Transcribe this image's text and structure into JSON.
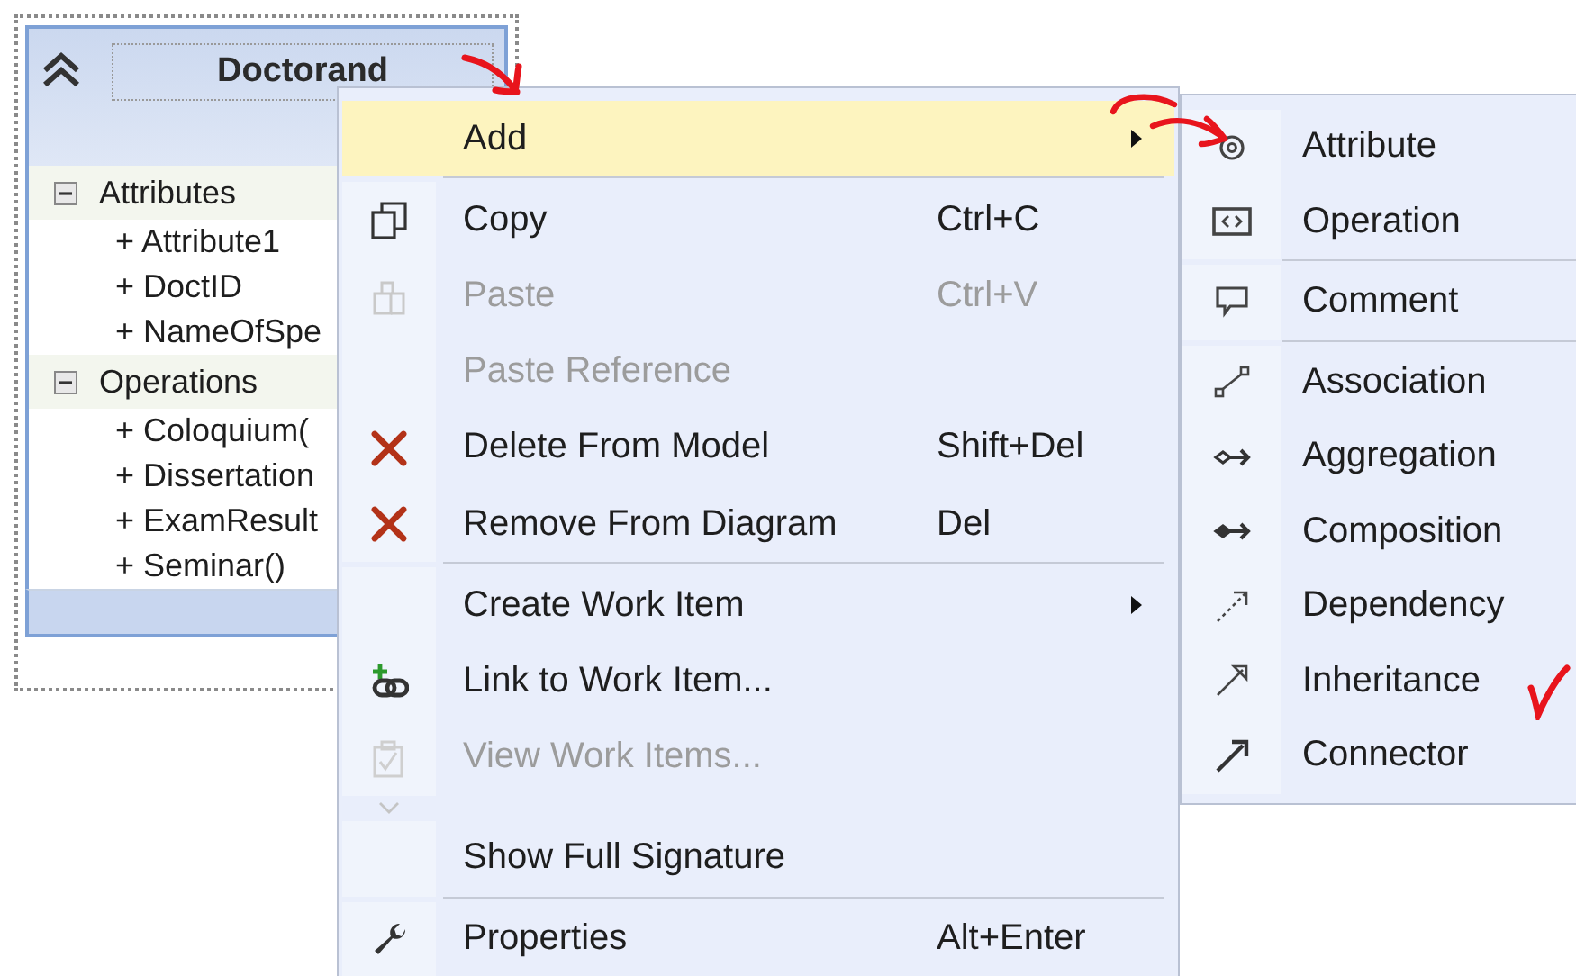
{
  "class_shape": {
    "title": "Doctorand",
    "compartments": [
      {
        "title": "Attributes",
        "expanded": true,
        "members": [
          "+ Attribute1",
          "+ DoctID",
          "+ NameOfSpe"
        ]
      },
      {
        "title": "Operations",
        "expanded": true,
        "members": [
          "+ Coloquium(",
          "+ Dissertation",
          "+ ExamResult",
          "+ Seminar()"
        ]
      }
    ]
  },
  "context_menu": {
    "items": [
      {
        "label": "Add",
        "kind": "add",
        "selected": true,
        "disabled": false,
        "submenu": true,
        "separator_before": false
      },
      {
        "label": "Copy",
        "kind": "copy",
        "shortcut": "Ctrl+C",
        "selected": false,
        "disabled": false,
        "submenu": false,
        "separator_before": true
      },
      {
        "label": "Paste",
        "kind": "paste",
        "shortcut": "Ctrl+V",
        "selected": false,
        "disabled": true,
        "submenu": false,
        "separator_before": false
      },
      {
        "label": "Paste Reference",
        "kind": "plain",
        "selected": false,
        "disabled": true,
        "submenu": false,
        "separator_before": false
      },
      {
        "label": "Delete From Model",
        "kind": "delete",
        "shortcut": "Shift+Del",
        "selected": false,
        "disabled": false,
        "submenu": false,
        "separator_before": false
      },
      {
        "label": "Remove From Diagram",
        "kind": "delete",
        "shortcut": "Del",
        "selected": false,
        "disabled": false,
        "submenu": false,
        "separator_before": false
      },
      {
        "label": "Create Work Item",
        "kind": "plain",
        "selected": false,
        "disabled": false,
        "submenu": true,
        "separator_before": true
      },
      {
        "label": "Link to Work Item...",
        "kind": "link",
        "selected": false,
        "disabled": false,
        "submenu": false,
        "separator_before": false
      },
      {
        "label": "View Work Items...",
        "kind": "view",
        "selected": false,
        "disabled": true,
        "submenu": false,
        "separator_before": false
      },
      {
        "kind": "hidden"
      },
      {
        "label": "Show Full Signature",
        "kind": "plain",
        "selected": false,
        "disabled": false,
        "submenu": false,
        "separator_before": false
      },
      {
        "label": "Properties",
        "kind": "properties",
        "shortcut": "Alt+Enter",
        "selected": false,
        "disabled": false,
        "submenu": false,
        "separator_before": true
      }
    ]
  },
  "add_submenu": {
    "items": [
      {
        "label": "Attribute",
        "kind": "attribute",
        "separator_before": false
      },
      {
        "label": "Operation",
        "kind": "operation",
        "separator_before": false
      },
      {
        "label": "Comment",
        "kind": "comment",
        "separator_before": true
      },
      {
        "label": "Association",
        "kind": "association",
        "separator_before": true
      },
      {
        "label": "Aggregation",
        "kind": "aggregation",
        "separator_before": false
      },
      {
        "label": "Composition",
        "kind": "composition",
        "separator_before": false
      },
      {
        "label": "Dependency",
        "kind": "dependency",
        "separator_before": false
      },
      {
        "label": "Inheritance",
        "kind": "inheritance",
        "separator_before": false
      },
      {
        "label": "Connector",
        "kind": "connector",
        "separator_before": false
      }
    ]
  }
}
